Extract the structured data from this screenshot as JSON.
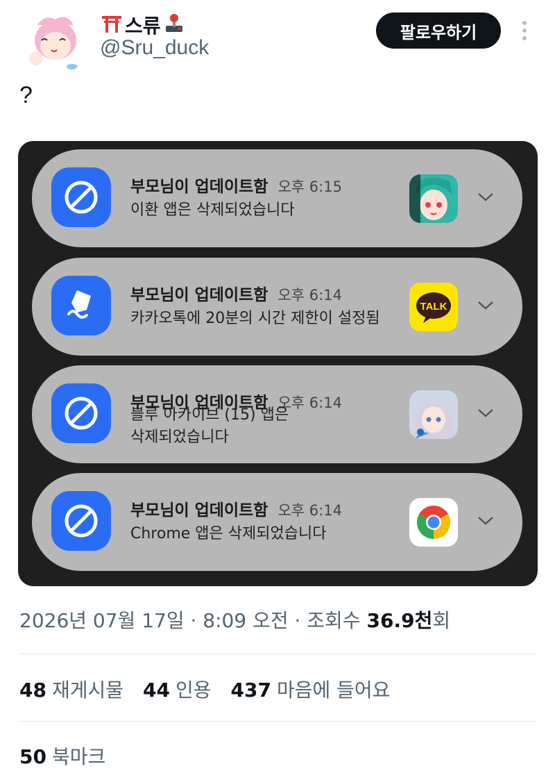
{
  "header": {
    "display_name": "스류",
    "emoji_left": "⛩️",
    "emoji_right": "🕹️",
    "handle": "@Sru_duck",
    "follow_label": "팔로우하기"
  },
  "tweet": {
    "text": "?"
  },
  "notifications": [
    {
      "app_icon": "block-icon",
      "title": "부모님이 업데이트함",
      "time": "오후 6:15",
      "body": "이환 앱은 삭제되었습니다",
      "thumbnail": "game-character-thumbnail"
    },
    {
      "app_icon": "timer-icon",
      "title": "부모님이 업데이트함",
      "time": "오후 6:14",
      "body": "카카오톡에 20분의 시간 제한이 설정됨",
      "thumbnail": "kakaotalk-icon",
      "thumb_text": "TALK"
    },
    {
      "app_icon": "block-icon",
      "title": "부모님이 업데이트함",
      "time": "오후 6:14",
      "body": "블루 아카이브 (15) 앱은",
      "body2": "삭제되었습니다",
      "thumbnail": "bluearchive-character-thumbnail"
    },
    {
      "app_icon": "block-icon",
      "title": "부모님이 업데이트함",
      "time": "오후 6:14",
      "body": "Chrome 앱은 삭제되었습니다",
      "thumbnail": "chrome-icon"
    }
  ],
  "meta": {
    "date_time": "2026년 07월 17일 · 8:09 오전 · 조회수 ",
    "views": "36.9천",
    "views_unit": "회"
  },
  "stats": {
    "retweets_count": "48",
    "retweets_label": "재게시물",
    "quotes_count": "44",
    "quotes_label": "인용",
    "likes_count": "437",
    "likes_label": "마음에 들어요",
    "bookmarks_count": "50",
    "bookmarks_label": "북마크"
  },
  "colors": {
    "accent_blue": "#2a6df4",
    "card_bg": "#1f1f1f",
    "notif_bg": "#b7b7b7",
    "kakao_yellow": "#fee500"
  }
}
